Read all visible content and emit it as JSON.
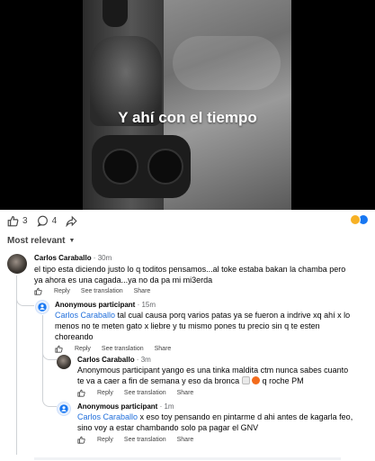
{
  "video": {
    "caption": "Y ahí con el tiempo"
  },
  "actions": {
    "likes_count": "3",
    "comments_count": "4",
    "reactions": [
      "wow",
      "like"
    ],
    "colors": {
      "wow": "#f7b125",
      "like": "#1877f2",
      "mention": "#216fdb"
    }
  },
  "sort": {
    "label": "Most relevant"
  },
  "comments": [
    {
      "name": "Carlos Caraballo",
      "time": " · 30m",
      "text_line1": "el tipo esta diciendo justo lo q toditos pensamos...al toke estaba bakan la chamba pero",
      "text_line2": "ya ahora es una cagada...ya no da pa mi mi3erda",
      "reply_label": "Reply",
      "see_translation_label": "See translation",
      "share_label": "Share"
    },
    {
      "name": "Anonymous participant",
      "time": " · 15m",
      "mention": "Carlos Caraballo",
      "text_line1": " tal cual causa porq varios patas ya se fueron a indrive xq ahí x lo",
      "text_line2": "menos no te meten gato x liebre y tu mismo pones tu precio sin q te esten",
      "text_line3": "choreando",
      "reply_label": "Reply",
      "see_translation_label": "See translation",
      "share_label": "Share"
    },
    {
      "name": "Carlos Caraballo",
      "time": " · 3m",
      "text_line1": "Anonymous participant yango es una tinka maldita ctm nunca sabes cuanto",
      "text_line2_a": "te va a caer a fin de semana y eso da bronca ",
      "text_line2_b": " q roche PM",
      "reply_label": "Reply",
      "see_translation_label": "See translation",
      "share_label": "Share"
    },
    {
      "name": "Anonymous participant",
      "time": " · 1m",
      "mention": "Carlos Caraballo",
      "text_line1": " x eso toy pensando en pintarme d ahi antes de kagarla feo,",
      "text_line2": "sino voy a estar chambando solo pa pagar el GNV",
      "reply_label": "Reply",
      "see_translation_label": "See translation",
      "share_label": "Share"
    }
  ]
}
